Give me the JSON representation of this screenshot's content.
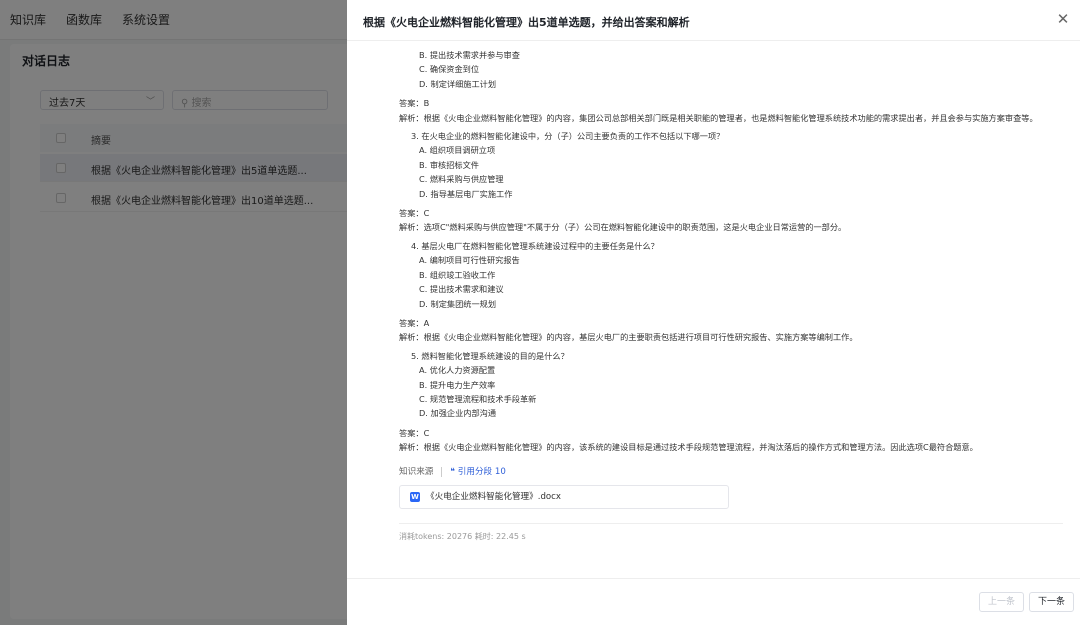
{
  "nav": {
    "items": [
      "知识库",
      "函数库",
      "系统设置"
    ]
  },
  "log_panel": {
    "title": "对话日志",
    "filter_value": "过去7天",
    "search_placeholder": "搜索",
    "table_header": "摘要",
    "rows": [
      "根据《火电企业燃料智能化管理》出5道单选题...",
      "根据《火电企业燃料智能化管理》出10道单选题..."
    ]
  },
  "drawer": {
    "title": "根据《火电企业燃料智能化管理》出5道单选题，并给出答案和解析",
    "lines": [
      {
        "kind": "opt",
        "text": "B. 提出技术需求并参与审查"
      },
      {
        "kind": "opt",
        "text": "C. 确保资金到位"
      },
      {
        "kind": "opt",
        "text": "D. 制定详细施工计划"
      },
      {
        "kind": "ans",
        "text": "答案：B"
      },
      {
        "kind": "exp",
        "text": "解析：根据《火电企业燃料智能化管理》的内容，集团公司总部相关部门既是相关职能的管理者，也是燃料智能化管理系统技术功能的需求提出者，并且会参与实施方案审查等。"
      },
      {
        "kind": "q",
        "text": "3. 在火电企业的燃料智能化建设中，分（子）公司主要负责的工作不包括以下哪一项？"
      },
      {
        "kind": "opt",
        "text": "A. 组织项目调研立项"
      },
      {
        "kind": "opt",
        "text": "B. 审核招标文件"
      },
      {
        "kind": "opt",
        "text": "C. 燃料采购与供应管理"
      },
      {
        "kind": "opt",
        "text": "D. 指导基层电厂实施工作"
      },
      {
        "kind": "ans",
        "text": "答案：C"
      },
      {
        "kind": "exp",
        "text": "解析：选项C\"燃料采购与供应管理\"不属于分（子）公司在燃料智能化建设中的职责范围，这是火电企业日常运营的一部分。"
      },
      {
        "kind": "q",
        "text": "4. 基层火电厂在燃料智能化管理系统建设过程中的主要任务是什么？"
      },
      {
        "kind": "opt",
        "text": "A. 编制项目可行性研究报告"
      },
      {
        "kind": "opt",
        "text": "B. 组织竣工验收工作"
      },
      {
        "kind": "opt",
        "text": "C. 提出技术需求和建议"
      },
      {
        "kind": "opt",
        "text": "D. 制定集团统一规划"
      },
      {
        "kind": "ans",
        "text": "答案：A"
      },
      {
        "kind": "exp",
        "text": "解析：根据《火电企业燃料智能化管理》的内容，基层火电厂的主要职责包括进行项目可行性研究报告、实施方案等编制工作。"
      },
      {
        "kind": "q",
        "text": "5. 燃料智能化管理系统建设的目的是什么？"
      },
      {
        "kind": "opt",
        "text": "A. 优化人力资源配置"
      },
      {
        "kind": "opt",
        "text": "B. 提升电力生产效率"
      },
      {
        "kind": "opt",
        "text": "C. 规范管理流程和技术手段革新"
      },
      {
        "kind": "opt",
        "text": "D. 加强企业内部沟通"
      },
      {
        "kind": "ans",
        "text": "答案：C"
      },
      {
        "kind": "exp",
        "text": "解析：根据《火电企业燃料智能化管理》的内容，该系统的建设目标是通过技术手段规范管理流程，并淘汰落后的操作方式和管理方法。因此选项C最符合题意。"
      }
    ],
    "source_label": "知识来源",
    "citation_label": "引用分段 10",
    "file_name": "《火电企业燃料智能化管理》.docx",
    "tokens_text": "消耗tokens: 20276  耗时: 22.45 s",
    "prev_label": "上一条",
    "next_label": "下一条"
  }
}
